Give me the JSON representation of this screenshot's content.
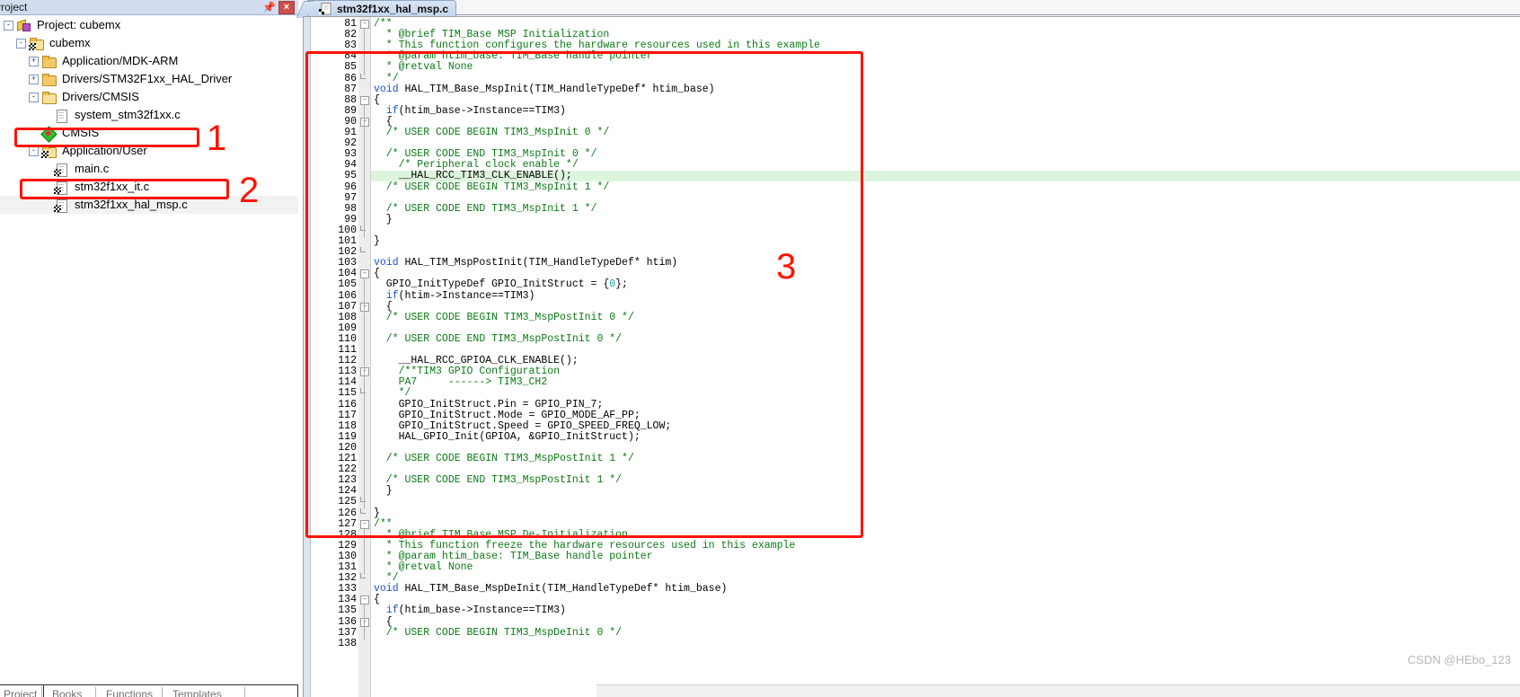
{
  "project_pane": {
    "title": "Project",
    "pin_icon": "pin-icon",
    "close_icon": "×",
    "tree": [
      {
        "depth": 0,
        "label": "Project: cubemx",
        "icon": "project-icon",
        "expander": "-",
        "selected": false
      },
      {
        "depth": 1,
        "label": "cubemx",
        "icon": "folder-group-icon",
        "expander": "-",
        "selected": false
      },
      {
        "depth": 2,
        "label": "Application/MDK-ARM",
        "icon": "folder-icon",
        "expander": "+",
        "selected": false
      },
      {
        "depth": 2,
        "label": "Drivers/STM32F1xx_HAL_Driver",
        "icon": "folder-icon",
        "expander": "+",
        "selected": false
      },
      {
        "depth": 2,
        "label": "Drivers/CMSIS",
        "icon": "folder-open-icon",
        "expander": "-",
        "selected": false
      },
      {
        "depth": 3,
        "label": "system_stm32f1xx.c",
        "icon": "document-icon",
        "expander": "",
        "selected": false
      },
      {
        "depth": 2,
        "label": "CMSIS",
        "icon": "diamond-icon",
        "expander": "",
        "selected": false
      },
      {
        "depth": 2,
        "label": "Application/User",
        "icon": "folder-group-open-icon",
        "expander": "-",
        "selected": false
      },
      {
        "depth": 3,
        "label": "main.c",
        "icon": "c-source-icon",
        "expander": "",
        "selected": false
      },
      {
        "depth": 3,
        "label": "stm32f1xx_it.c",
        "icon": "c-source-icon",
        "expander": "",
        "selected": false
      },
      {
        "depth": 3,
        "label": "stm32f1xx_hal_msp.c",
        "icon": "c-source-icon",
        "expander": "",
        "selected": true
      }
    ],
    "bottom_tabs": [
      "Project",
      "Books",
      "Functions",
      "Templates"
    ]
  },
  "editor": {
    "tab_label": "stm32f1xx_hal_msp.c",
    "tab_icon": "c-source-icon",
    "first_line_number": 81,
    "highlighted_line": 95,
    "lines": [
      {
        "n": 81,
        "fold": "-",
        "text": "/**",
        "kind": "cmt"
      },
      {
        "n": 82,
        "fold": "",
        "text": "  * @brief TIM_Base MSP Initialization",
        "kind": "cmt"
      },
      {
        "n": 83,
        "fold": "",
        "text": "  * This function configures the hardware resources used in this example",
        "kind": "cmt"
      },
      {
        "n": 84,
        "fold": "",
        "text": "  * @param htim_base: TIM_Base handle pointer",
        "kind": "cmt"
      },
      {
        "n": 85,
        "fold": "",
        "text": "  * @retval None",
        "kind": "cmt"
      },
      {
        "n": 86,
        "fold": "L",
        "text": "  */",
        "kind": "cmt"
      },
      {
        "n": 87,
        "fold": "",
        "text": "void HAL_TIM_Base_MspInit(TIM_HandleTypeDef* htim_base)",
        "kind": "code_void"
      },
      {
        "n": 88,
        "fold": "-",
        "text": "{",
        "kind": "code"
      },
      {
        "n": 89,
        "fold": "",
        "text": "  if(htim_base->Instance==TIM3)",
        "kind": "code_if"
      },
      {
        "n": 90,
        "fold": "-",
        "text": "  {",
        "kind": "code"
      },
      {
        "n": 91,
        "fold": "",
        "text": "  /* USER CODE BEGIN TIM3_MspInit 0 */",
        "kind": "cmt"
      },
      {
        "n": 92,
        "fold": "",
        "text": "",
        "kind": "code"
      },
      {
        "n": 93,
        "fold": "",
        "text": "  /* USER CODE END TIM3_MspInit 0 */",
        "kind": "cmt"
      },
      {
        "n": 94,
        "fold": "",
        "text": "    /* Peripheral clock enable */",
        "kind": "cmt"
      },
      {
        "n": 95,
        "fold": "",
        "text": "    __HAL_RCC_TIM3_CLK_ENABLE();",
        "kind": "code"
      },
      {
        "n": 96,
        "fold": "",
        "text": "  /* USER CODE BEGIN TIM3_MspInit 1 */",
        "kind": "cmt"
      },
      {
        "n": 97,
        "fold": "",
        "text": "",
        "kind": "code"
      },
      {
        "n": 98,
        "fold": "",
        "text": "  /* USER CODE END TIM3_MspInit 1 */",
        "kind": "cmt"
      },
      {
        "n": 99,
        "fold": "",
        "text": "  }",
        "kind": "code"
      },
      {
        "n": 100,
        "fold": "L",
        "text": "",
        "kind": "code"
      },
      {
        "n": 101,
        "fold": "",
        "text": "}",
        "kind": "code"
      },
      {
        "n": 102,
        "fold": "L",
        "text": "",
        "kind": "code"
      },
      {
        "n": 103,
        "fold": "",
        "text": "void HAL_TIM_MspPostInit(TIM_HandleTypeDef* htim)",
        "kind": "code_void"
      },
      {
        "n": 104,
        "fold": "-",
        "text": "{",
        "kind": "code"
      },
      {
        "n": 105,
        "fold": "",
        "text": "  GPIO_InitTypeDef GPIO_InitStruct = {0};",
        "kind": "code_brace0"
      },
      {
        "n": 106,
        "fold": "",
        "text": "  if(htim->Instance==TIM3)",
        "kind": "code_if"
      },
      {
        "n": 107,
        "fold": "-",
        "text": "  {",
        "kind": "code"
      },
      {
        "n": 108,
        "fold": "",
        "text": "  /* USER CODE BEGIN TIM3_MspPostInit 0 */",
        "kind": "cmt"
      },
      {
        "n": 109,
        "fold": "",
        "text": "",
        "kind": "code"
      },
      {
        "n": 110,
        "fold": "",
        "text": "  /* USER CODE END TIM3_MspPostInit 0 */",
        "kind": "cmt"
      },
      {
        "n": 111,
        "fold": "",
        "text": "",
        "kind": "code"
      },
      {
        "n": 112,
        "fold": "",
        "text": "    __HAL_RCC_GPIOA_CLK_ENABLE();",
        "kind": "code"
      },
      {
        "n": 113,
        "fold": "-",
        "text": "    /**TIM3 GPIO Configuration",
        "kind": "cmt"
      },
      {
        "n": 114,
        "fold": "",
        "text": "    PA7     ------> TIM3_CH2",
        "kind": "cmt"
      },
      {
        "n": 115,
        "fold": "L",
        "text": "    */",
        "kind": "cmt"
      },
      {
        "n": 116,
        "fold": "",
        "text": "    GPIO_InitStruct.Pin = GPIO_PIN_7;",
        "kind": "code"
      },
      {
        "n": 117,
        "fold": "",
        "text": "    GPIO_InitStruct.Mode = GPIO_MODE_AF_PP;",
        "kind": "code"
      },
      {
        "n": 118,
        "fold": "",
        "text": "    GPIO_InitStruct.Speed = GPIO_SPEED_FREQ_LOW;",
        "kind": "code"
      },
      {
        "n": 119,
        "fold": "",
        "text": "    HAL_GPIO_Init(GPIOA, &GPIO_InitStruct);",
        "kind": "code"
      },
      {
        "n": 120,
        "fold": "",
        "text": "",
        "kind": "code"
      },
      {
        "n": 121,
        "fold": "",
        "text": "  /* USER CODE BEGIN TIM3_MspPostInit 1 */",
        "kind": "cmt"
      },
      {
        "n": 122,
        "fold": "",
        "text": "",
        "kind": "code"
      },
      {
        "n": 123,
        "fold": "",
        "text": "  /* USER CODE END TIM3_MspPostInit 1 */",
        "kind": "cmt"
      },
      {
        "n": 124,
        "fold": "",
        "text": "  }",
        "kind": "code"
      },
      {
        "n": 125,
        "fold": "L",
        "text": "",
        "kind": "code"
      },
      {
        "n": 126,
        "fold": "L",
        "text": "}",
        "kind": "code"
      },
      {
        "n": 127,
        "fold": "-",
        "text": "/**",
        "kind": "cmt"
      },
      {
        "n": 128,
        "fold": "",
        "text": "  * @brief TIM_Base MSP De-Initialization",
        "kind": "cmt"
      },
      {
        "n": 129,
        "fold": "",
        "text": "  * This function freeze the hardware resources used in this example",
        "kind": "cmt"
      },
      {
        "n": 130,
        "fold": "",
        "text": "  * @param htim_base: TIM_Base handle pointer",
        "kind": "cmt"
      },
      {
        "n": 131,
        "fold": "",
        "text": "  * @retval None",
        "kind": "cmt"
      },
      {
        "n": 132,
        "fold": "L",
        "text": "  */",
        "kind": "cmt"
      },
      {
        "n": 133,
        "fold": "",
        "text": "void HAL_TIM_Base_MspDeInit(TIM_HandleTypeDef* htim_base)",
        "kind": "code_void"
      },
      {
        "n": 134,
        "fold": "-",
        "text": "{",
        "kind": "code"
      },
      {
        "n": 135,
        "fold": "",
        "text": "  if(htim_base->Instance==TIM3)",
        "kind": "code_if"
      },
      {
        "n": 136,
        "fold": "-",
        "text": "  {",
        "kind": "code"
      },
      {
        "n": 137,
        "fold": "",
        "text": "  /* USER CODE BEGIN TIM3_MspDeInit 0 */",
        "kind": "cmt"
      },
      {
        "n": 138,
        "fold": "",
        "text": "",
        "kind": "code"
      }
    ]
  },
  "annotations": [
    {
      "label": "1",
      "target": "Application/User tree row"
    },
    {
      "label": "2",
      "target": "stm32f1xx_hal_msp.c tree row"
    },
    {
      "label": "3",
      "target": "MSP init code region"
    }
  ],
  "watermark": "CSDN @HEbo_123",
  "colors": {
    "annotation_red": "#ff1200",
    "comment_green": "#0a7a14",
    "keyword_blue": "#1a53cf",
    "number_teal": "#11a3a3",
    "highlight_green": "#ddf5dd",
    "tab_blue": "#c4d5ec"
  }
}
